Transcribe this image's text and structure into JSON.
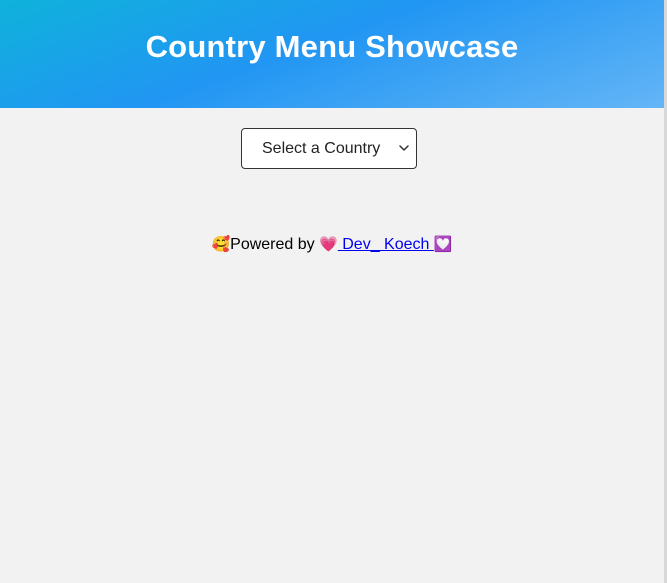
{
  "header": {
    "title": "Country Menu Showcase"
  },
  "country_select": {
    "selected_label": "Select a Country",
    "options": [
      "Select a Country"
    ]
  },
  "footer": {
    "lead_emoji": "🥰",
    "prefix": "Powered by",
    "link_emoji_left": "💗",
    "link_text": "Dev_ Koech",
    "link_emoji_right": "💟"
  },
  "colors": {
    "header_gradient_start": "#0fb2db",
    "header_gradient_mid": "#2196f3",
    "header_gradient_end": "#64b5f6",
    "page_background": "#f2f2f2",
    "link": "#0000ee"
  },
  "icons": {
    "select_arrow": "chevron-down-icon"
  }
}
